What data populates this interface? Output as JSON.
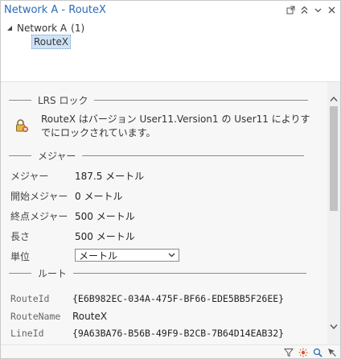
{
  "window": {
    "title": "Network A - RouteX",
    "buttons": [
      "pop-out-icon",
      "collapse-all-icon",
      "menu-icon",
      "close-icon"
    ]
  },
  "tree": {
    "network_label": "Network A",
    "network_count": "(1)",
    "route_label": "RouteX"
  },
  "lrs_lock": {
    "header": "LRS ロック",
    "message": "RouteX はバージョン User11.Version1 の User11 によりすでにロックされています。",
    "icon": "lock-icon"
  },
  "measure": {
    "header": "メジャー",
    "rows": [
      {
        "label": "メジャー",
        "value": "187.5 メートル"
      },
      {
        "label": "開始メジャー",
        "value": "0 メートル"
      },
      {
        "label": "終点メジャー",
        "value": "500 メートル"
      },
      {
        "label": "長さ",
        "value": "500 メートル"
      }
    ],
    "unit_label": "単位",
    "unit_value": "メートル"
  },
  "route": {
    "header": "ルート",
    "route_id_label": "RouteId",
    "route_id_value": "{E6B982EC-034A-475F-BF66-EDE5BB5F26EE}",
    "route_name_label": "RouteName",
    "route_name_value": "RouteX",
    "line_id_label": "LineId",
    "line_id_value": "{9A63BA76-B56B-49F9-B2CB-7B64D14EAB32}"
  },
  "footer": {
    "buttons": [
      "filter-icon",
      "flash-icon",
      "zoom-to-icon",
      "pan-to-icon"
    ]
  },
  "colors": {
    "title": "#2a6bb8",
    "selection": "#cfe3f7",
    "lock_accent": "#d9541e"
  }
}
